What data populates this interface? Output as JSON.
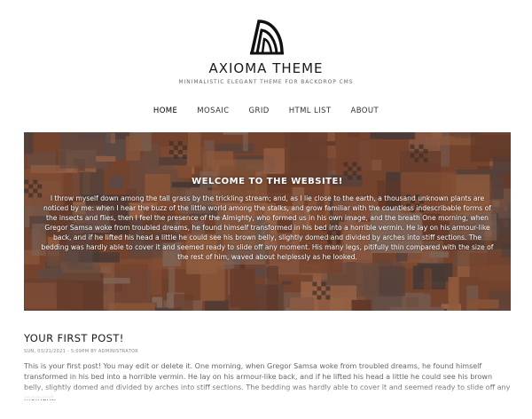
{
  "site": {
    "title": "AXIOMA THEME",
    "slogan": "MINIMALISTIC ELEGANT THEME FOR BACKDROP CMS",
    "logo_icon": "axioma-logo-icon"
  },
  "nav": {
    "items": [
      {
        "label": "HOME",
        "active": true
      },
      {
        "label": "MOSAIC"
      },
      {
        "label": "GRID"
      },
      {
        "label": "HTML LIST"
      },
      {
        "label": "ABOUT"
      }
    ]
  },
  "hero": {
    "title": "WELCOME TO THE WEBSITE!",
    "text": "I throw myself down among the tall grass by the trickling stream; and, as I lie close to the earth, a thousand unknown plants are noticed by me: when I hear the buzz of the little world among the stalks, and grow familiar with the countless indescribable forms of the insects and flies, then I feel the presence of the Almighty, who formed us in his own image, and the breath  One morning, when Gregor Samsa woke from troubled dreams, he found himself transformed in his bed into a horrible vermin. He lay on his armour-like back, and if he lifted his head a little he could see his brown belly, slightly domed and divided by arches into stiff sections. The bedding was hardly able to cover it and seemed ready to slide off any moment. His many legs, pitifully thin compared with the size of the rest of him, waved about helplessly as he looked."
  },
  "post": {
    "title": "YOUR FIRST POST!",
    "meta": "SUN, 03/21/2021 - 5:09PM BY ADMINISTRATOR",
    "body": "This is your first post! You may edit or delete it. One morning, when Gregor Samsa woke from troubled dreams, he found himself transformed in his bed into a horrible vermin. He lay on his armour-like back, and if he lifted his head a little he could see his brown belly, slightly domed and divided by arches into stiff sections. The bedding was hardly able to cover it and seemed ready to slide off any moment."
  },
  "colors": {
    "hero_base": "#8a4d32",
    "text_dark": "#1a1a1a",
    "text_muted": "#666666"
  }
}
